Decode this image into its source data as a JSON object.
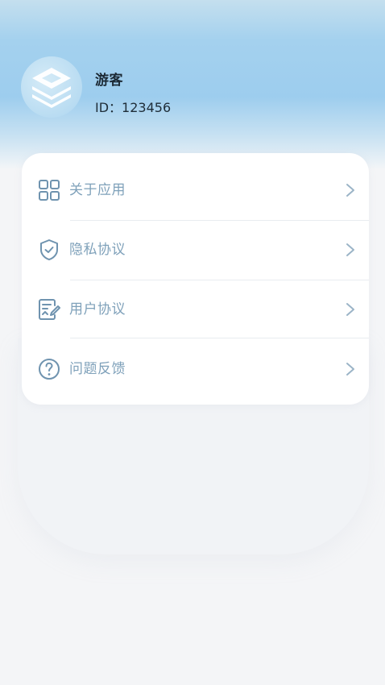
{
  "profile": {
    "name": "游客",
    "id_text": "ID：123456"
  },
  "menu": {
    "items": [
      {
        "label": "关于应用",
        "icon": "grid-icon"
      },
      {
        "label": "隐私协议",
        "icon": "shield-check-icon"
      },
      {
        "label": "用户协议",
        "icon": "document-edit-icon"
      },
      {
        "label": "问题反馈",
        "icon": "help-circle-icon"
      }
    ]
  },
  "colors": {
    "header_gradient": "#a4d1ee",
    "icon_color": "#6f93af",
    "label_color": "#7fa1ba",
    "chevron_color": "#9bb4c7",
    "background": "#f4f5f7",
    "card": "#ffffff"
  }
}
